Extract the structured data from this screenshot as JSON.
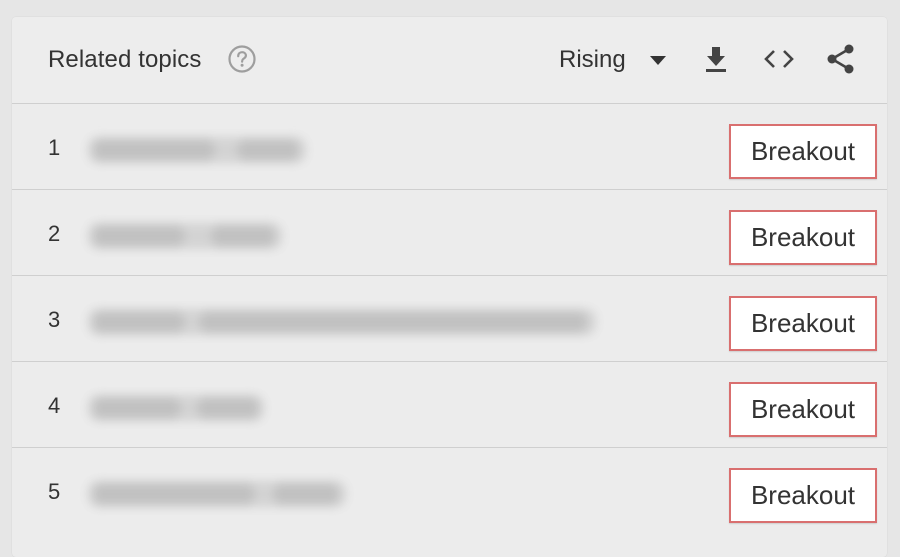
{
  "header": {
    "title": "Related topics",
    "help_icon": "help-circle-icon",
    "mode": {
      "selected": "Rising"
    },
    "tools": [
      "download-icon",
      "embed-code-icon",
      "share-icon"
    ]
  },
  "rows": [
    {
      "rank": "1",
      "topic": "",
      "value": "Breakout"
    },
    {
      "rank": "2",
      "topic": "",
      "value": "Breakout"
    },
    {
      "rank": "3",
      "topic": "",
      "value": "Breakout"
    },
    {
      "rank": "4",
      "topic": "",
      "value": "Breakout"
    },
    {
      "rank": "5",
      "topic": "",
      "value": "Breakout"
    }
  ],
  "colors": {
    "badge_border": "#d96f6f",
    "text": "#333333",
    "icon": "#444444",
    "help_icon": "#9e9e9e",
    "divider": "#cfcfcf"
  }
}
